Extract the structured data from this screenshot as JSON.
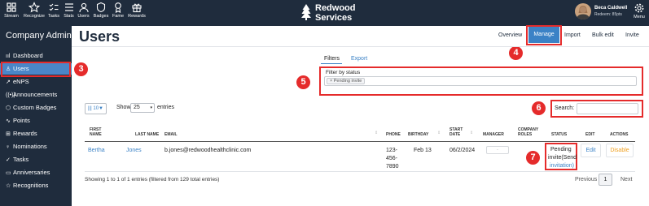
{
  "topnav": {
    "items": [
      {
        "label": "Stream",
        "icon": "grid-icon"
      },
      {
        "label": "Recognize",
        "icon": "star-icon"
      },
      {
        "label": "Tasks",
        "icon": "checklist-icon"
      },
      {
        "label": "Stats",
        "icon": "stats-icon"
      },
      {
        "label": "Users",
        "icon": "users-icon"
      },
      {
        "label": "Badges",
        "icon": "shield-icon"
      },
      {
        "label": "Fame",
        "icon": "trophy-icon"
      },
      {
        "label": "Rewards",
        "icon": "gift-icon"
      }
    ],
    "brand_line1": "Redwood",
    "brand_line2": "Services",
    "user_name": "Beca Caldwell",
    "user_points": "Redeem: 85pts",
    "menu_label": "Menu"
  },
  "sidebar": {
    "title": "Company Admin",
    "items": [
      {
        "label": "Dashboard",
        "icon": "ııl"
      },
      {
        "label": "Users",
        "icon": "♙"
      },
      {
        "label": "eNPS",
        "icon": "↗"
      },
      {
        "label": "Announcements",
        "icon": "((•))"
      },
      {
        "label": "Custom Badges",
        "icon": "⬡"
      },
      {
        "label": "Points",
        "icon": "∿"
      },
      {
        "label": "Rewards",
        "icon": "⊞"
      },
      {
        "label": "Nominations",
        "icon": "♀"
      },
      {
        "label": "Tasks",
        "icon": "✓"
      },
      {
        "label": "Anniversaries",
        "icon": "▭"
      },
      {
        "label": "Recognitions",
        "icon": "☆"
      }
    ]
  },
  "header": {
    "title": "Users",
    "tabs": [
      "Overview",
      "Manage",
      "Import",
      "Bulk edit",
      "Invite"
    ]
  },
  "filters": {
    "tabs": [
      "Filters",
      "Export"
    ],
    "status_label": "Filter by status",
    "status_chip": "× Pending invite"
  },
  "controls": {
    "columns_btn": "|||  10▼",
    "show_label": "Show",
    "page_length": "25",
    "entries_label": "entries",
    "search_label": "Search:"
  },
  "table": {
    "headers": [
      "FIRST NAME",
      "LAST NAME",
      "EMAIL",
      "PHONE",
      "BIRTHDAY",
      "START DATE",
      "MANAGER",
      "COMPANY ROLES",
      "STATUS",
      "EDIT",
      "ACTIONS"
    ],
    "rows": [
      {
        "first": "Bertha",
        "last": "Jones",
        "email": "b.jones@redwoodhealthclinic.com",
        "phone_lines": [
          "123-",
          "456-",
          "7890"
        ],
        "birthday": "Feb 13",
        "start": "06/2/2024",
        "manager": "-",
        "status_text": "Pending",
        "status_lines": [
          "invite(Send",
          "invitation)"
        ],
        "edit": "Edit",
        "action": "Disable"
      }
    ],
    "info": "Showing 1 to 1 of 1 entries (filtered from 129 total entries)",
    "pagination": {
      "prev": "Previous",
      "current": "1",
      "next": "Next"
    }
  },
  "annotations": [
    "3",
    "4",
    "5",
    "6",
    "7"
  ],
  "colors": {
    "nav_bg": "#1f2c3d",
    "accent": "#3b82c6",
    "highlight": "#e52b2b",
    "warning": "#f0a020"
  }
}
